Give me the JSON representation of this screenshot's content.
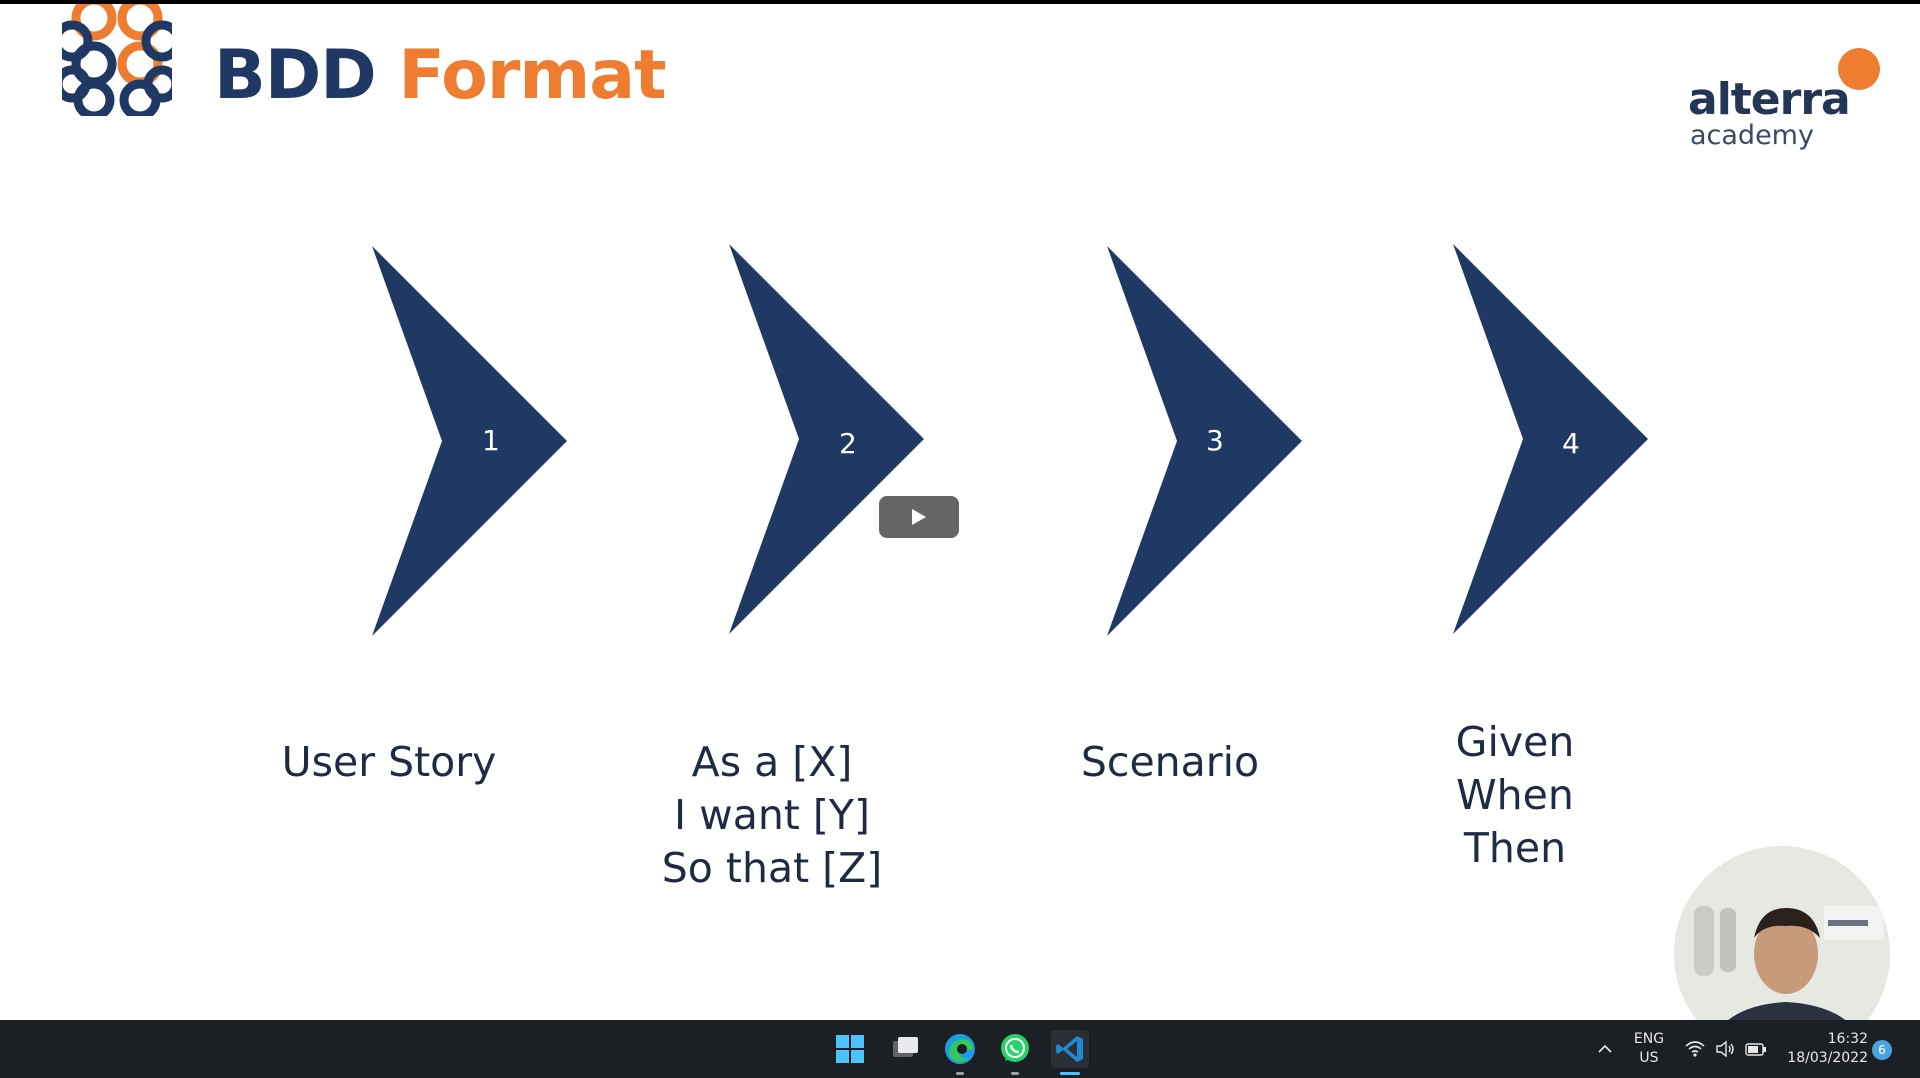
{
  "slide": {
    "title_part1": "BDD",
    "title_part2": "Format",
    "brand": {
      "name": "alterra",
      "sub": "academy"
    },
    "steps": [
      {
        "number": "1",
        "label_lines": [
          "User Story"
        ]
      },
      {
        "number": "2",
        "label_lines": [
          "As a [X]",
          "I want [Y]",
          "So that [Z]"
        ]
      },
      {
        "number": "3",
        "label_lines": [
          "Scenario"
        ]
      },
      {
        "number": "4",
        "label_lines": [
          "Given",
          "When",
          "Then"
        ]
      }
    ]
  },
  "colors": {
    "navy": "#1f3864",
    "orange": "#ee7d31",
    "taskbar": "#1c1f24"
  },
  "video_controls": {
    "play_icon": "play-icon"
  },
  "taskbar": {
    "apps": [
      "windows-start-icon",
      "task-view-icon",
      "edge-icon",
      "whatsapp-icon",
      "vscode-icon"
    ],
    "language": {
      "line1": "ENG",
      "line2": "US"
    },
    "clock": {
      "time": "16:32",
      "date": "18/03/2022"
    },
    "notification_count": "6"
  }
}
